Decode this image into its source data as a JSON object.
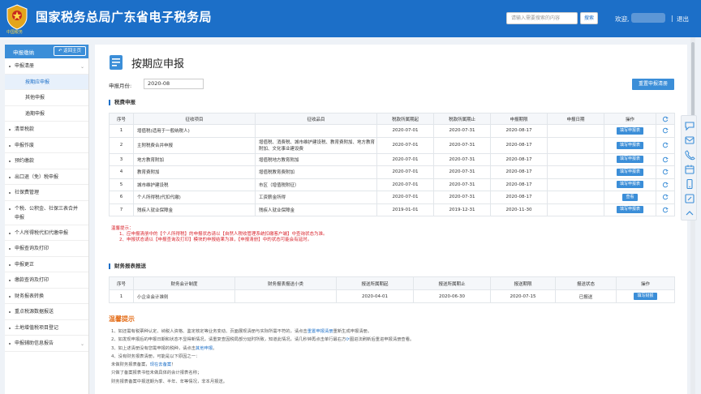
{
  "header": {
    "site_title": "国家税务总局广东省电子税务局",
    "logo_caption": "中国税务",
    "search_placeholder": "请输入需要搜索的内容",
    "search_button": "搜索",
    "welcome": "欢迎,",
    "separator": "|",
    "logout": "退出"
  },
  "sidebar": {
    "title": "申报缴纳",
    "back_label": "返回主页",
    "menu": [
      {
        "label": "申报清册",
        "expanded": true
      },
      {
        "label": "清单税款"
      },
      {
        "label": "申报作废"
      },
      {
        "label": "预约缴款"
      },
      {
        "label": "出口退（免）税申报"
      },
      {
        "label": "社保费管理"
      },
      {
        "label": "个税、公积金、社保三表合并申报"
      },
      {
        "label": "个人所得税代扣代缴申报"
      },
      {
        "label": "申报查询及打印"
      },
      {
        "label": "申报更正"
      },
      {
        "label": "缴款查询及打印"
      },
      {
        "label": "财务报表转换"
      },
      {
        "label": "重点税源数据报送"
      },
      {
        "label": "土地增值税项目登记"
      },
      {
        "label": "申报辅助信息报告"
      }
    ],
    "submenu": [
      {
        "label": "按期应申报",
        "active": true
      },
      {
        "label": "其他申报"
      },
      {
        "label": "逾期申报"
      }
    ]
  },
  "main": {
    "title": "按期应申报",
    "period_label": "申报月份:",
    "period_value": "2020-08",
    "reset_button": "重置申报清册",
    "tax_section_title": "税费申报",
    "tax_table": {
      "headers": [
        "序号",
        "征收项目",
        "征收品目",
        "税款所属期起",
        "税款所属期止",
        "申报期限",
        "申报日期",
        "操作"
      ],
      "rows": [
        {
          "no": "1",
          "item": "增值税(适用于一般纳税人)",
          "sub": "",
          "start": "2020-07-01",
          "end": "2020-07-31",
          "deadline": "2020-08-17",
          "date": "",
          "action": "填写申报表"
        },
        {
          "no": "2",
          "item": "主附税费合并申报",
          "sub": "增值税、消费税、城市维护建设税、教育费附加、地方教育附加、文化事业建设费",
          "start": "2020-07-01",
          "end": "2020-07-31",
          "deadline": "2020-08-17",
          "date": "",
          "action": "填写申报表"
        },
        {
          "no": "3",
          "item": "地方教育附加",
          "sub": "增值税地方教育附加",
          "start": "2020-07-01",
          "end": "2020-07-31",
          "deadline": "2020-08-17",
          "date": "",
          "action": "填写申报表"
        },
        {
          "no": "4",
          "item": "教育费附加",
          "sub": "增值税教育费附加",
          "start": "2020-07-01",
          "end": "2020-07-31",
          "deadline": "2020-08-17",
          "date": "",
          "action": "填写申报表"
        },
        {
          "no": "5",
          "item": "城市维护建设税",
          "sub": "市区（增值税附征）",
          "start": "2020-07-01",
          "end": "2020-07-31",
          "deadline": "2020-08-17",
          "date": "",
          "action": "填写申报表"
        },
        {
          "no": "6",
          "item": "个人所得税(代扣代缴)",
          "sub": "工资薪金所得",
          "start": "2020-07-01",
          "end": "2020-07-31",
          "deadline": "2020-08-17",
          "date": "",
          "action": "查看"
        },
        {
          "no": "7",
          "item": "残疾人就业保障金",
          "sub": "残疾人就业保障金",
          "start": "2019-01-01",
          "end": "2019-12-31",
          "deadline": "2020-11-30",
          "date": "",
          "action": "填写申报表"
        }
      ]
    },
    "notice": {
      "title": "温馨提示：",
      "lines": [
        "1、应申报清册中的【个人所得税】的申报状态请以【自然人税收管理系统扣缴客户端】中查询状态为准。",
        "2、申报状态请以【申报查询及打印】模块的申报结果为准，【申报清册】中的状态可能会有延时。"
      ]
    },
    "fin_section_title": "财务报表报送",
    "fin_table": {
      "headers": [
        "序号",
        "财务会计制度",
        "财务报表报送小类",
        "报送所属期起",
        "报送所属期止",
        "报送期限",
        "报送状态",
        "操作"
      ],
      "rows": [
        {
          "no": "1",
          "system": "小企业会计准则",
          "sub": "",
          "start": "2020-04-01",
          "end": "2020-06-30",
          "deadline": "2020-07-15",
          "status": "已报送",
          "action": "填写财报"
        }
      ]
    },
    "tips_title": "温馨提示",
    "tips": [
      {
        "text": "1、如还需有税票种认定、纳税人资格、鉴定核定等业务变动、页面展现清册与实际所需不符的，请点击",
        "link": "重置申报清册",
        "after": "重新生成申报清册。"
      },
      {
        "text": "2、如发现申报后的申报日期和状态不显得新情况，请重复查因税局部分延时所致，知道此情况，请几秒钟再点击单行最右方",
        "link": "⟳",
        "after": "图进法刷新后重进申报清册查看。"
      },
      {
        "text": "3、如上述清册没有您需申报的税种，请点击",
        "link": "其他申报",
        "after": "。"
      },
      {
        "text": "4、没有财务报表清册，可能是以下原因之一：",
        "link": "",
        "after": ""
      },
      {
        "text": "未做财务报表备案，",
        "link": "现在去备案",
        "after": "！"
      },
      {
        "text": "只做了备案报表书但未做具体的会计报表名称；",
        "link": "",
        "after": ""
      },
      {
        "text": "财务报表备案中报送期为季、半年、年等情况，非本月报送。",
        "link": "",
        "after": ""
      }
    ]
  },
  "colors": {
    "header_bg": "#1c6fc8",
    "accent": "#3b8ed8",
    "notice_red": "#d9262e",
    "tips_orange": "#e46e1a"
  },
  "icons": {
    "logo": "tax-emblem-icon",
    "refresh": "refresh-icon",
    "page": "document-icon"
  }
}
